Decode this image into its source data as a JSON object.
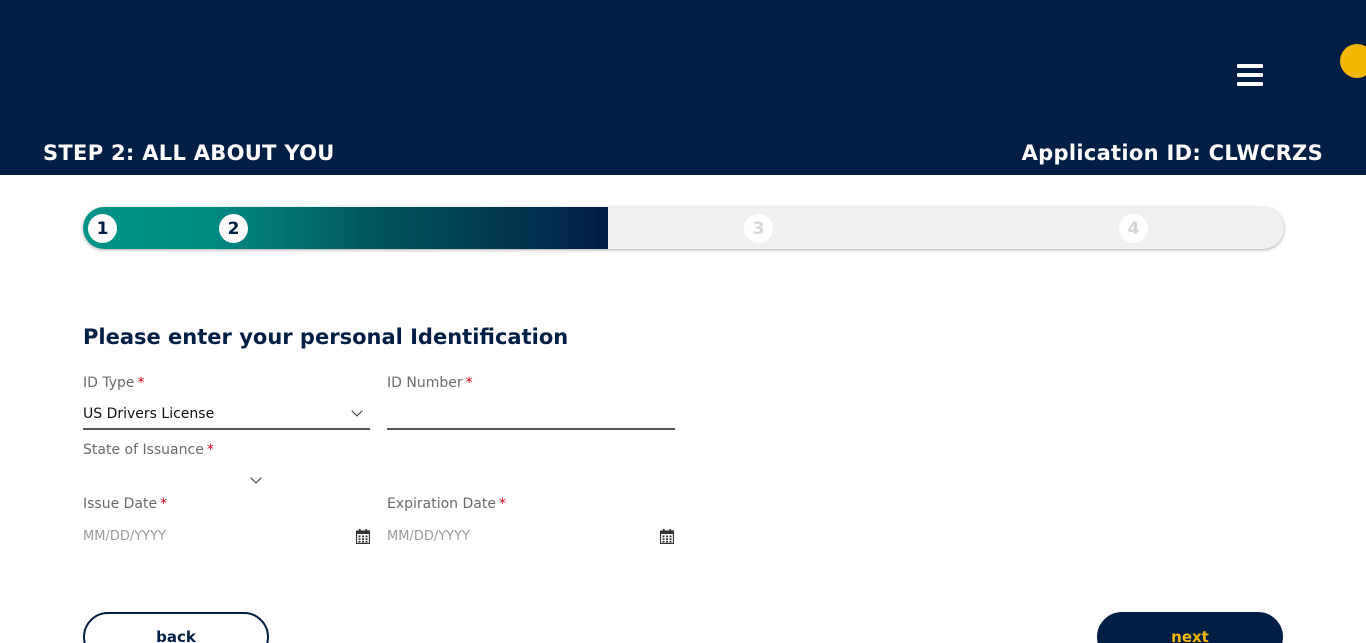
{
  "header": {
    "step_title": "STEP 2: ALL ABOUT YOU",
    "application_id": "Application ID: CLWCRZS",
    "background_color": "#021e45",
    "menu_icon": "hamburger-menu-icon",
    "help_icon": "help-icon"
  },
  "progress": {
    "current_step": 2,
    "total_steps": 4,
    "fill_fraction": 0.44,
    "steps": [
      "1",
      "2",
      "3",
      "4"
    ],
    "gradient_start_color": "#009488",
    "gradient_end_color": "#021e45"
  },
  "form": {
    "section_title": "Please enter your personal Identification",
    "required_marker": "*",
    "id_type": {
      "label": "ID Type",
      "value": "US Drivers License"
    },
    "id_number": {
      "label": "ID Number",
      "value": ""
    },
    "state_of_issuance": {
      "label": "State of Issuance",
      "value": ""
    },
    "issue_date": {
      "label": "Issue Date",
      "placeholder": "MM/DD/YYYY",
      "icon": "calendar-icon"
    },
    "expiration_date": {
      "label": "Expiration Date",
      "placeholder": "MM/DD/YYYY",
      "icon": "calendar-icon"
    }
  },
  "actions": {
    "back_label": "back",
    "next_label": "next",
    "next_text_color": "#f2b705"
  }
}
